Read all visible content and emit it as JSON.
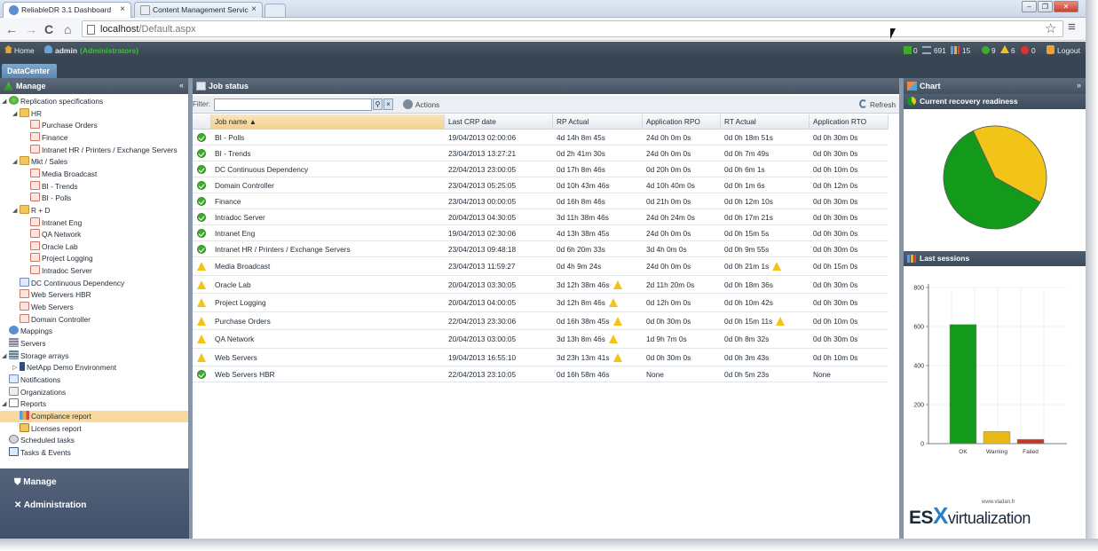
{
  "browser": {
    "tabs": [
      {
        "title": "ReliableDR 3.1 Dashboard",
        "close": "×"
      },
      {
        "title": "Content Management Servic",
        "close": "×"
      }
    ],
    "window_controls": [
      "–",
      "❐",
      "✕"
    ],
    "url_host": "localhost",
    "url_path": "/Default.aspx",
    "nav": {
      "back": "←",
      "forward": "→",
      "reload": "C",
      "home": "⌂",
      "star": "☆",
      "menu": "≡"
    }
  },
  "header": {
    "home_label": "Home",
    "user": "admin",
    "role": "(Administrators)",
    "stats": {
      "running": "0",
      "queued": "691",
      "bars": "15",
      "ok": "9",
      "warning": "6",
      "failed": "0"
    },
    "logout_label": "Logout"
  },
  "datacenter_tab": "DataCenter",
  "left_panel": {
    "title": "Manage",
    "tree": [
      {
        "label": "Replication specifications",
        "level": 0,
        "icon": "replication",
        "twisty": "open"
      },
      {
        "label": "HR",
        "level": 1,
        "icon": "folder",
        "twisty": "open"
      },
      {
        "label": "Purchase Orders",
        "level": 2,
        "icon": "doc"
      },
      {
        "label": "Finance",
        "level": 2,
        "icon": "doc"
      },
      {
        "label": "Intranet HR / Printers / Exchange Servers",
        "level": 2,
        "icon": "doc"
      },
      {
        "label": "Mkt / Sales",
        "level": 1,
        "icon": "folder",
        "twisty": "open"
      },
      {
        "label": "Media Broadcast",
        "level": 2,
        "icon": "doc"
      },
      {
        "label": "BI - Trends",
        "level": 2,
        "icon": "doc"
      },
      {
        "label": "BI - Polls",
        "level": 2,
        "icon": "doc"
      },
      {
        "label": "R + D",
        "level": 1,
        "icon": "folder",
        "twisty": "open"
      },
      {
        "label": "Intranet Eng",
        "level": 2,
        "icon": "doc"
      },
      {
        "label": "QA Network",
        "level": 2,
        "icon": "doc"
      },
      {
        "label": "Oracle Lab",
        "level": 2,
        "icon": "doc"
      },
      {
        "label": "Project Logging",
        "level": 2,
        "icon": "doc"
      },
      {
        "label": "Intradoc Server",
        "level": 2,
        "icon": "doc"
      },
      {
        "label": "DC Continuous Dependency",
        "level": 1,
        "icon": "docblue"
      },
      {
        "label": "Web Servers HBR",
        "level": 1,
        "icon": "doc"
      },
      {
        "label": "Web Servers",
        "level": 1,
        "icon": "doc"
      },
      {
        "label": "Domain Controller",
        "level": 1,
        "icon": "doc"
      },
      {
        "label": "Mappings",
        "level": 0,
        "icon": "mapping"
      },
      {
        "label": "Servers",
        "level": 0,
        "icon": "servers"
      },
      {
        "label": "Storage arrays",
        "level": 0,
        "icon": "storage",
        "twisty": "open"
      },
      {
        "label": "NetApp Demo Environment",
        "level": 1,
        "icon": "netapp",
        "twisty": "closed"
      },
      {
        "label": "Notifications",
        "level": 0,
        "icon": "notify"
      },
      {
        "label": "Organizations",
        "level": 0,
        "icon": "org"
      },
      {
        "label": "Reports",
        "level": 0,
        "icon": "reports",
        "twisty": "open"
      },
      {
        "label": "Compliance report",
        "level": 1,
        "icon": "chart",
        "selected": true
      },
      {
        "label": "Licenses report",
        "level": 1,
        "icon": "license"
      },
      {
        "label": "Scheduled tasks",
        "level": 0,
        "icon": "clock"
      },
      {
        "label": "Tasks & Events",
        "level": 0,
        "icon": "events"
      }
    ],
    "accordion": [
      {
        "label": "Manage",
        "icon": "shield-icon"
      },
      {
        "label": "Administration",
        "icon": "tools-icon"
      }
    ]
  },
  "job_status": {
    "title": "Job status",
    "filter_label": "Filter:",
    "filter_value": "",
    "actions_label": "Actions",
    "refresh_label": "Refresh",
    "columns": [
      "Job name",
      "Last CRP date",
      "RP Actual",
      "Application RPO",
      "RT Actual",
      "Application RTO"
    ],
    "rows": [
      {
        "status": "ok",
        "name": "BI - Polls",
        "crp": "19/04/2013 02:00:06",
        "rp": "4d 14h 8m 45s",
        "rpo": "24d 0h 0m 0s",
        "rt": "0d 0h 18m 51s",
        "rto": "0d 0h 30m 0s"
      },
      {
        "status": "ok",
        "name": "BI - Trends",
        "crp": "23/04/2013 13:27:21",
        "rp": "0d 2h 41m 30s",
        "rpo": "24d 0h 0m 0s",
        "rt": "0d 0h 7m 49s",
        "rto": "0d 0h 30m 0s"
      },
      {
        "status": "ok",
        "name": "DC Continuous Dependency",
        "crp": "22/04/2013 23:00:05",
        "rp": "0d 17h 8m 46s",
        "rpo": "0d 20h 0m 0s",
        "rt": "0d 0h 6m 1s",
        "rto": "0d 0h 10m 0s"
      },
      {
        "status": "ok",
        "name": "Domain Controller",
        "crp": "23/04/2013 05:25:05",
        "rp": "0d 10h 43m 46s",
        "rpo": "4d 10h 40m 0s",
        "rt": "0d 0h 1m 6s",
        "rto": "0d 0h 12m 0s"
      },
      {
        "status": "ok",
        "name": "Finance",
        "crp": "23/04/2013 00:00:05",
        "rp": "0d 16h 8m 46s",
        "rpo": "0d 21h 0m 0s",
        "rt": "0d 0h 12m 10s",
        "rto": "0d 0h 30m 0s"
      },
      {
        "status": "ok",
        "name": "Intradoc Server",
        "crp": "20/04/2013 04:30:05",
        "rp": "3d 11h 38m 46s",
        "rpo": "24d 0h 24m 0s",
        "rt": "0d 0h 17m 21s",
        "rto": "0d 0h 30m 0s"
      },
      {
        "status": "ok",
        "name": "Intranet Eng",
        "crp": "19/04/2013 02:30:06",
        "rp": "4d 13h 38m 45s",
        "rpo": "24d 0h 0m 0s",
        "rt": "0d 0h 15m 5s",
        "rto": "0d 0h 30m 0s"
      },
      {
        "status": "ok",
        "name": "Intranet HR / Printers / Exchange Servers",
        "crp": "23/04/2013 09:48:18",
        "rp": "0d 6h 20m 33s",
        "rpo": "3d 4h 0m 0s",
        "rt": "0d 0h 9m 55s",
        "rto": "0d 0h 30m 0s"
      },
      {
        "status": "warning",
        "name": "Media Broadcast",
        "crp": "23/04/2013 11:59:27",
        "rp": "0d 4h 9m 24s",
        "rpo": "24d 0h 0m 0s",
        "rt": "0d 0h 21m 1s",
        "rto": "0d 0h 15m 0s",
        "rt_warn": true
      },
      {
        "status": "warning",
        "name": "Oracle Lab",
        "crp": "20/04/2013 03:30:05",
        "rp": "3d 12h 38m 46s",
        "rpo": "2d 11h 20m 0s",
        "rt": "0d 0h 18m 36s",
        "rto": "0d 0h 30m 0s",
        "rp_warn": true
      },
      {
        "status": "warning",
        "name": "Project Logging",
        "crp": "20/04/2013 04:00:05",
        "rp": "3d 12h 8m 46s",
        "rpo": "0d 12h 0m 0s",
        "rt": "0d 0h 10m 42s",
        "rto": "0d 0h 30m 0s",
        "rp_warn": true
      },
      {
        "status": "warning",
        "name": "Purchase Orders",
        "crp": "22/04/2013 23:30:06",
        "rp": "0d 16h 38m 45s",
        "rpo": "0d 0h 30m 0s",
        "rt": "0d 0h 15m 11s",
        "rto": "0d 0h 10m 0s",
        "rp_warn": true,
        "rt_warn": true
      },
      {
        "status": "warning",
        "name": "QA Network",
        "crp": "20/04/2013 03:00:05",
        "rp": "3d 13h 8m 46s",
        "rpo": "1d 9h 7m 0s",
        "rt": "0d 0h 8m 32s",
        "rto": "0d 0h 30m 0s",
        "rp_warn": true
      },
      {
        "status": "warning",
        "name": "Web Servers",
        "crp": "19/04/2013 16:55:10",
        "rp": "3d 23h 13m 41s",
        "rpo": "0d 0h 30m 0s",
        "rt": "0d 0h 3m 43s",
        "rto": "0d 0h 10m 0s",
        "rp_warn": true
      },
      {
        "status": "ok",
        "name": "Web Servers HBR",
        "crp": "22/04/2013 23:10:05",
        "rp": "0d 16h 58m 46s",
        "rpo": "None",
        "rt": "0d 0h 5m 23s",
        "rto": "None"
      }
    ]
  },
  "chart_panel": {
    "title": "Chart",
    "readiness_title": "Current recovery readiness",
    "sessions_title": "Last sessions"
  },
  "chart_data": [
    {
      "type": "pie",
      "title": "Current recovery readiness",
      "slices": [
        {
          "label": "",
          "value": 9,
          "color": "#149a1b"
        },
        {
          "label": "",
          "value": 6,
          "color": "#f2c418"
        }
      ]
    },
    {
      "type": "bar",
      "title": "Last sessions",
      "categories": [
        "OK",
        "Warning",
        "Failed"
      ],
      "values": [
        610,
        62,
        22
      ],
      "colors": [
        "#149a1b",
        "#e8b915",
        "#c0392b"
      ],
      "yticks": [
        0,
        200,
        400,
        600,
        800
      ],
      "ylim": [
        0,
        800
      ]
    }
  ],
  "watermark": {
    "url": "www.vladan.fr",
    "brand_prefix": "ES",
    "brand_x": "X",
    "brand_suffix": "virtualization"
  }
}
